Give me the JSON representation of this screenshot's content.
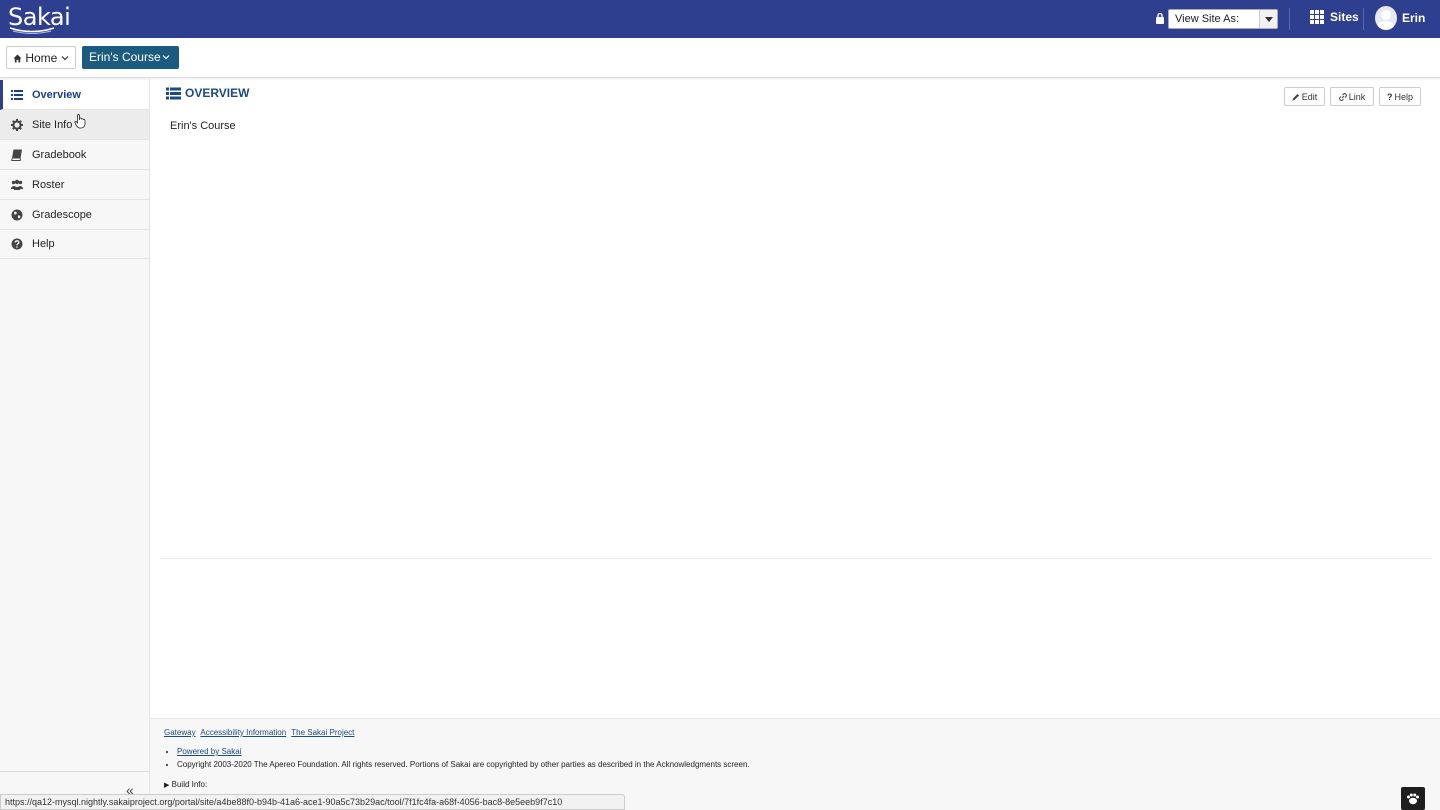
{
  "header": {
    "logo_text": "Sakai",
    "view_site_as": "View Site As:",
    "sites_label": "Sites",
    "user_name": "Erin",
    "bg_color": "#2e3f8f"
  },
  "site_nav": {
    "home_label": "Home",
    "course_label": "Erin's Course",
    "course_color": "#1c5b80"
  },
  "sidebar": {
    "items": [
      {
        "label": "Overview",
        "icon": "list-icon",
        "active": true
      },
      {
        "label": "Site Info",
        "icon": "gear-icon"
      },
      {
        "label": "Gradebook",
        "icon": "book-icon"
      },
      {
        "label": "Roster",
        "icon": "users-icon"
      },
      {
        "label": "Gradescope",
        "icon": "globe-icon"
      },
      {
        "label": "Help",
        "icon": "question-circle-icon"
      }
    ],
    "collapse_glyph": "«"
  },
  "main": {
    "tool_title": "OVERVIEW",
    "buttons": {
      "edit": "Edit",
      "link": "Link",
      "help": "Help"
    },
    "course_title": "Erin's Course"
  },
  "footer": {
    "links": [
      "Gateway",
      "Accessibility Information",
      "The Sakai Project"
    ],
    "powered_by": "Powered by Sakai",
    "copyright": "Copyright 2003-2020 The Apereo Foundation. All rights reserved. Portions of Sakai are copyrighted by other parties as described in the Acknowledgments screen.",
    "build_info": "Build Info:"
  },
  "status_url": "https://qa12-mysql.nightly.sakaiproject.org/portal/site/a4be88f0-b94b-41a6-ace1-90a5c73b29ac/tool/7f1fc4fa-a68f-4056-bac8-8e5eeb9f7c10"
}
